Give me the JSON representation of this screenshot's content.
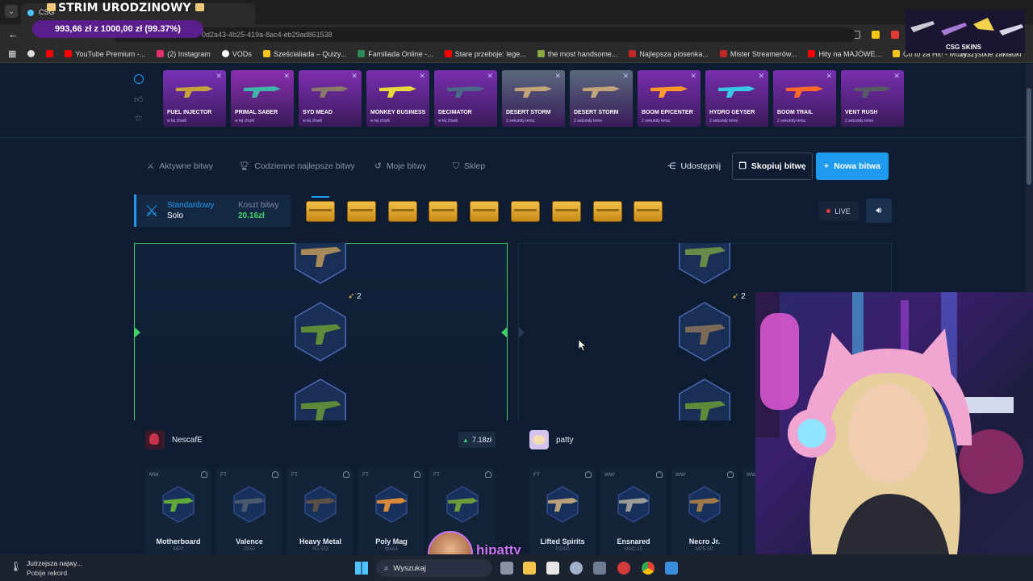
{
  "overlay": {
    "stream_title": "STRIM URODZINOWY",
    "goal_text": "993,66 zł z 1000,00 zł (99.37%)",
    "goal_fraction": 0.9937,
    "brand": "CSG SKINS",
    "viewer_name": "hipatty"
  },
  "browser": {
    "tab_title": "CSG",
    "url_fragment": "0d2a43-4b25-419a-8ac4-eb29ad861538",
    "bookmarks": [
      {
        "label": "YouTube Premium -...",
        "color": "#ff0000"
      },
      {
        "label": "(2) Instagram",
        "color": "#e1306c"
      },
      {
        "label": "VODs",
        "color": "#ffffff"
      },
      {
        "label": "Sześcialiada – Quizy...",
        "color": "#f5c518"
      },
      {
        "label": "Familiada Online -...",
        "color": "#2e8b57"
      },
      {
        "label": "Stare przeboje: lege...",
        "color": "#ff0000"
      },
      {
        "label": "the most handsome...",
        "color": "#88aa44"
      },
      {
        "label": "Najlepsza piosenka...",
        "color": "#c62828"
      },
      {
        "label": "Mister Streamerów...",
        "color": "#c62828"
      },
      {
        "label": "Hity na MAJÓWE...",
        "color": "#ff0000"
      },
      {
        "label": "Co to za Hit! - Muzy...",
        "color": "#f5c518"
      }
    ],
    "bookmarks_end": "Wszystkie zakładki"
  },
  "live_drops": [
    {
      "name": "FUEL INJECTOR",
      "sub": "w tej chwili",
      "bg": "#7a32b8",
      "gun": "#c8a33a"
    },
    {
      "name": "PRIMAL SABER",
      "sub": "w tej chwili",
      "bg": "#8a2fb0",
      "gun": "#3fb7a8"
    },
    {
      "name": "SYD MEAD",
      "sub": "w tej chwili",
      "bg": "#7e2fb0",
      "gun": "#8a7a6a"
    },
    {
      "name": "MONKEY BUSINESS",
      "sub": "w tej chwili",
      "bg": "#7a2fb2",
      "gun": "#e8d93a"
    },
    {
      "name": "DECIMATOR",
      "sub": "w tej chwili",
      "bg": "#7a2fb0",
      "gun": "#4a6a8a"
    },
    {
      "name": "DESERT STORM",
      "sub": "2 sekundy temu",
      "bg": "#5a6a7e",
      "gun": "#c2a37a"
    },
    {
      "name": "DESERT STORM",
      "sub": "2 sekundy temu",
      "bg": "#5a6a7e",
      "gun": "#c2a37a"
    },
    {
      "name": "BOOM EPICENTER",
      "sub": "2 sekundy temu",
      "bg": "#7a2fb0",
      "gun": "#ff9a2a"
    },
    {
      "name": "HYDRO GEYSER",
      "sub": "2 sekundy temu",
      "bg": "#7a2fb0",
      "gun": "#3ac8e8"
    },
    {
      "name": "BOOM TRAIL",
      "sub": "2 sekundy temu",
      "bg": "#7a2fb0",
      "gun": "#ff6a2a"
    },
    {
      "name": "VENT RUSH",
      "sub": "2 sekundy temu",
      "bg": "#7a2fb0",
      "gun": "#555c68"
    }
  ],
  "nav": {
    "active_battles": "Aktywne bitwy",
    "daily_best": "Codzienne najlepsze bitwy",
    "my_battles": "Moje bitwy",
    "shop": "Sklep",
    "share": "Udostępnij",
    "copy_battle": "Skopiuj bitwę",
    "new_battle": "Nowa bitwa"
  },
  "battle": {
    "mode": "Standardowy",
    "mode_type": "Solo",
    "cost_label": "Koszt bitwy",
    "cost_value": "20.16zł",
    "crate_count": 9,
    "live_label": "LIVE",
    "round": "2"
  },
  "players": [
    {
      "name": "NescafE",
      "total": "7.18zł",
      "items": [
        {
          "cond": "MW",
          "name": "Motherboard",
          "type": "MP7",
          "color": "#5fa83a"
        },
        {
          "cond": "FT",
          "name": "Valence",
          "type": "P250",
          "color": "#4a5a6e"
        },
        {
          "cond": "FT",
          "name": "Heavy Metal",
          "type": "SG 553",
          "color": "#5a5048"
        },
        {
          "cond": "FT",
          "name": "Poly Mag",
          "type": "M4A4",
          "color": "#d88a3a"
        },
        {
          "cond": "FT",
          "name": "",
          "type": "",
          "color": "#6a9a3a"
        }
      ]
    },
    {
      "name": "patty",
      "total": "",
      "items": [
        {
          "cond": "FT",
          "name": "Lifted Spirits",
          "type": "P2000",
          "color": "#b8a07a"
        },
        {
          "cond": "WW",
          "name": "Ensnared",
          "type": "MAC-10",
          "color": "#9a9a9a"
        },
        {
          "cond": "WW",
          "name": "Necro Jr.",
          "type": "MP5-SD",
          "color": "#a0784a"
        },
        {
          "cond": "WW",
          "name": "",
          "type": "",
          "color": "#555"
        }
      ]
    }
  ],
  "taskbar": {
    "weather_title": "Jutrzejsza najwy...",
    "weather_sub": "Pobije rekord",
    "search_label": "Wyszukaj"
  }
}
